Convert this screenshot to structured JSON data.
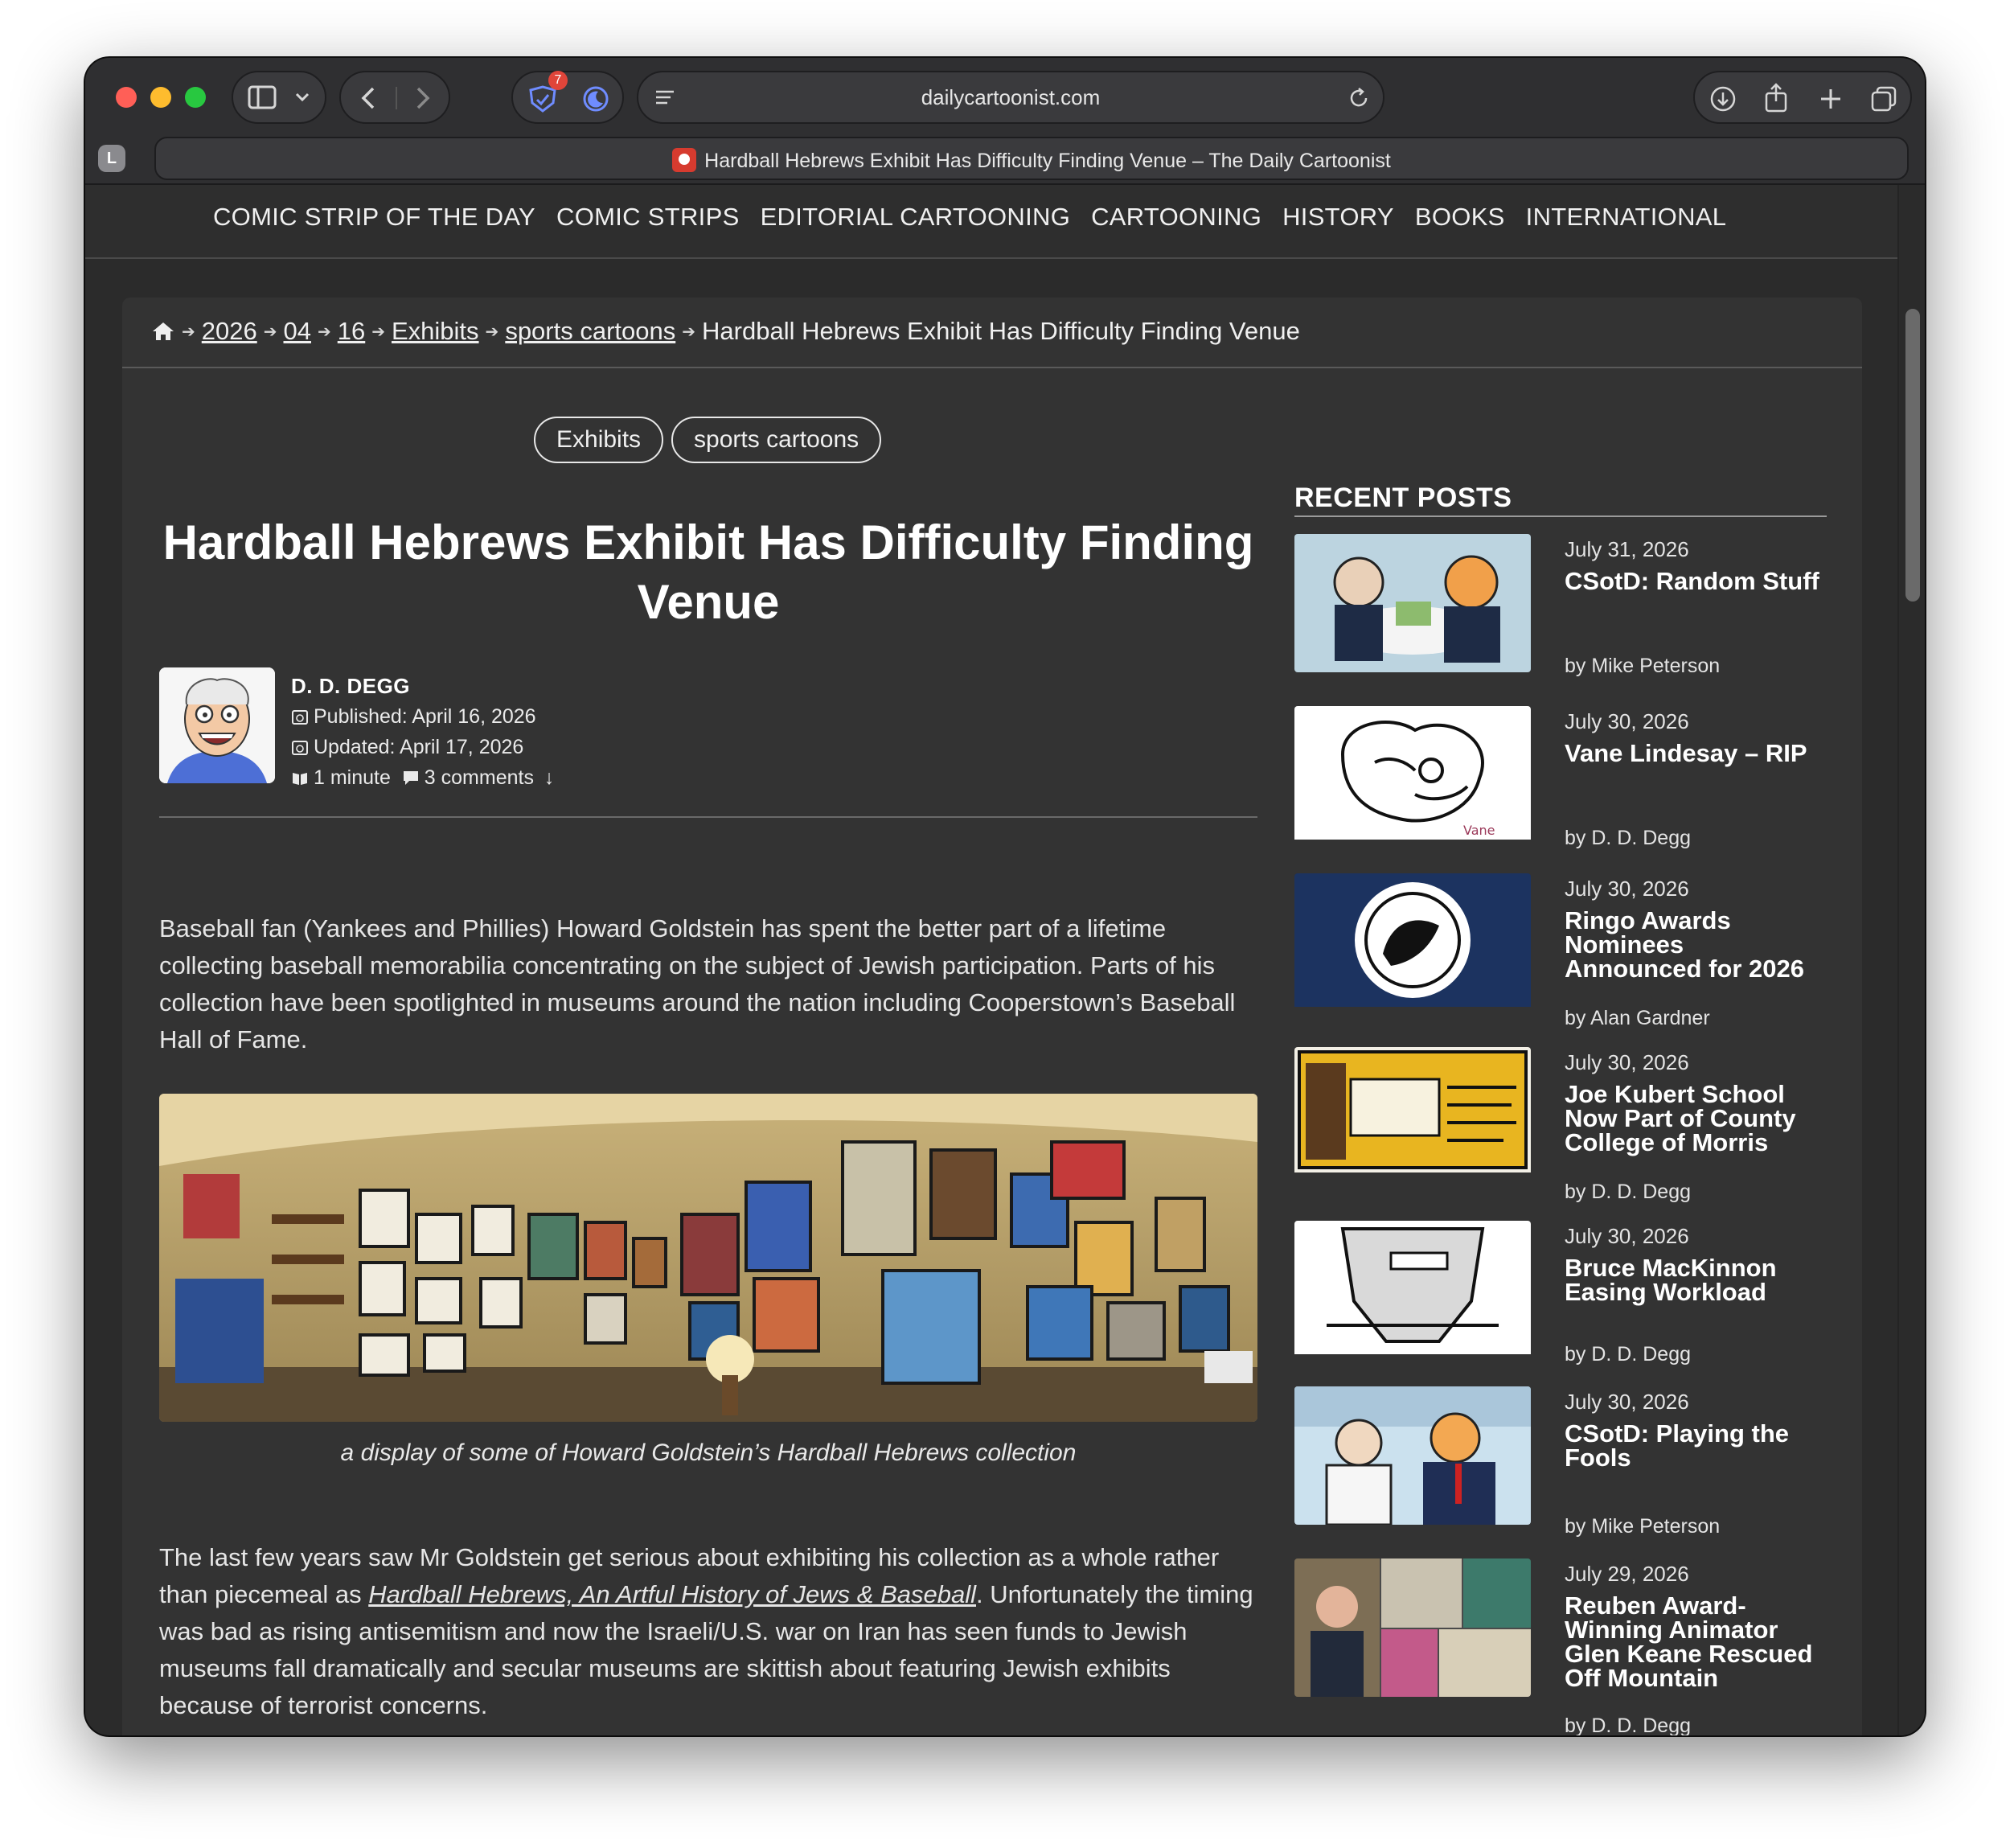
{
  "browser": {
    "url": "dailycartoonist.com",
    "tab_title": "Hardball Hebrews Exhibit Has Difficulty Finding Venue – The Daily Cartoonist",
    "profile_initial": "L",
    "extension_badge": "7"
  },
  "nav": {
    "items": [
      "COMIC STRIP OF THE DAY",
      "COMIC STRIPS",
      "EDITORIAL CARTOONING",
      "CARTOONING",
      "HISTORY",
      "BOOKS",
      "INTERNATIONAL"
    ]
  },
  "breadcrumb": {
    "year": "2026",
    "month": "04",
    "day": "16",
    "category": "Exhibits",
    "tag": "sports cartoons",
    "current": "Hardball Hebrews Exhibit Has Difficulty Finding Venue"
  },
  "tags": [
    "Exhibits",
    "sports cartoons"
  ],
  "article": {
    "title": "Hardball Hebrews Exhibit Has Difficulty Finding Venue",
    "author": "D. D. DEGG",
    "published": "Published: April 16, 2026",
    "updated": "Updated: April 17, 2026",
    "read_time": "1 minute",
    "comments": "3 comments",
    "para1": "Baseball fan (Yankees and Phillies) Howard Goldstein has spent the better part of a lifetime collecting baseball memorabilia concentrating on the subject of Jewish participation. Parts of his collection have been spotlighted in museums around the nation including Cooperstown’s Baseball Hall of Fame.",
    "caption": "a display of some of Howard Goldstein’s Hardball Hebrews collection",
    "para2_before": "The last few years saw Mr Goldstein get serious about exhibiting his collection as a whole rather than piecemeal as ",
    "para2_link": "Hardball Hebrews, An Artful History of Jews & Baseball",
    "para2_after": ". Unfortunately the timing was bad as rising antisemitism and now the Israeli/U.S. war on Iran has seen funds to Jewish museums fall dramatically and secular museums are skittish about featuring Jewish exhibits because of terrorist concerns."
  },
  "recent_posts": {
    "heading": "RECENT POSTS",
    "posts": [
      {
        "date": "July 31, 2026",
        "title": "CSotD: Random Stuff",
        "byline": "by Mike Peterson"
      },
      {
        "date": "July 30, 2026",
        "title": "Vane Lindesay – RIP",
        "byline": "by D. D. Degg"
      },
      {
        "date": "July 30, 2026",
        "title": "Ringo Awards Nominees Announced for 2026",
        "byline": "by Alan Gardner"
      },
      {
        "date": "July 30, 2026",
        "title": "Joe Kubert School Now Part of County College of Morris",
        "byline": "by D. D. Degg"
      },
      {
        "date": "July 30, 2026",
        "title": "Bruce MacKinnon Easing Workload",
        "byline": "by D. D. Degg"
      },
      {
        "date": "July 30, 2026",
        "title": "CSotD: Playing the Fools",
        "byline": "by Mike Peterson"
      },
      {
        "date": "July 29, 2026",
        "title": "Reuben Award-Winning Animator Glen Keane Rescued Off Mountain",
        "byline": "by D. D. Degg"
      }
    ]
  },
  "colors": {
    "page_bg": "#2b2b2b",
    "card_bg": "#333333",
    "text": "#e6e6e6",
    "traffic_red": "#ff5f57",
    "traffic_yellow": "#febc2e",
    "traffic_green": "#28c840"
  }
}
